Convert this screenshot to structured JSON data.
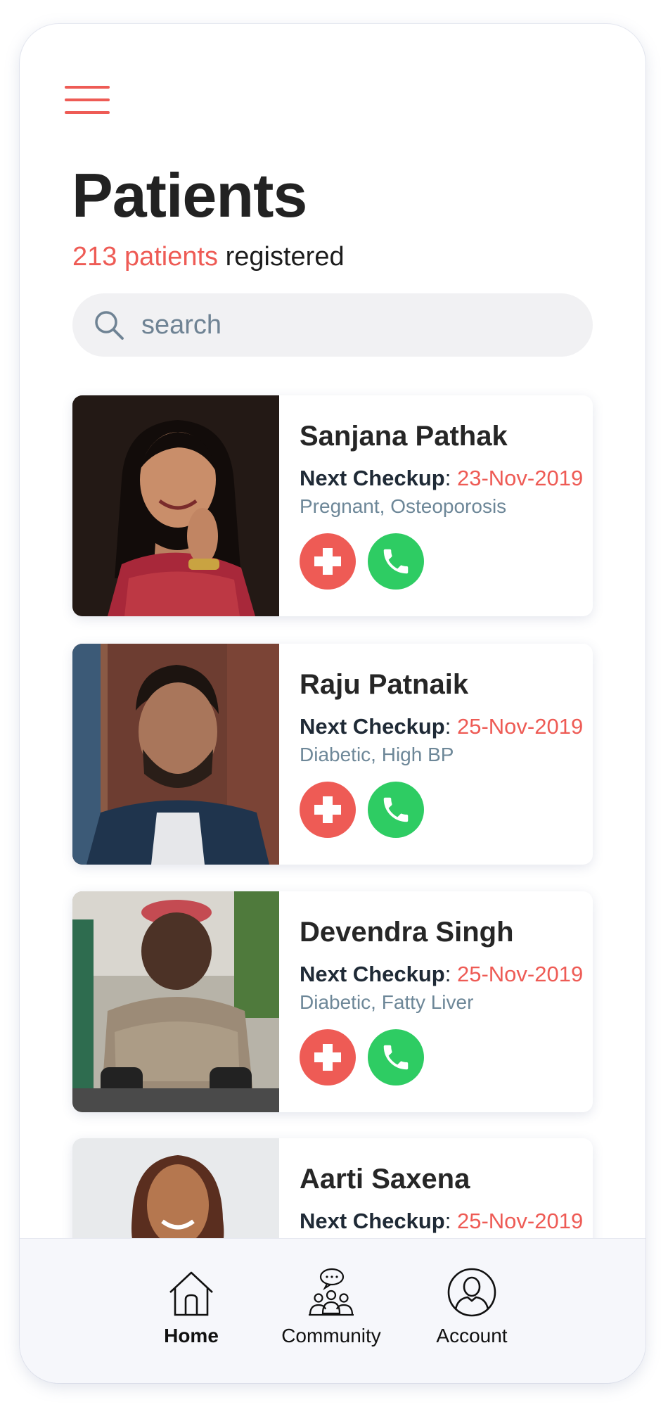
{
  "header": {
    "title": "Patients",
    "count_text": "213 patients",
    "count_suffix": "registered"
  },
  "search": {
    "placeholder": "search",
    "value": ""
  },
  "checkup_label": "Next Checkup",
  "patients": [
    {
      "name": "Sanjana Pathak",
      "next_checkup": "23-Nov-2019",
      "conditions": "Pregnant, Osteoporosis"
    },
    {
      "name": "Raju Patnaik",
      "next_checkup": "25-Nov-2019",
      "conditions": "Diabetic, High BP"
    },
    {
      "name": "Devendra Singh",
      "next_checkup": "25-Nov-2019",
      "conditions": "Diabetic, Fatty Liver"
    },
    {
      "name": "Aarti Saxena",
      "next_checkup": "25-Nov-2019",
      "conditions": ""
    }
  ],
  "nav": {
    "home": "Home",
    "community": "Community",
    "account": "Account"
  },
  "colors": {
    "accent": "#ee5b55",
    "call": "#2ecc63",
    "muted": "#6d8798"
  },
  "icons": [
    "menu-icon",
    "search-icon",
    "medical-cross-icon",
    "phone-icon",
    "home-icon",
    "community-icon",
    "account-icon"
  ]
}
